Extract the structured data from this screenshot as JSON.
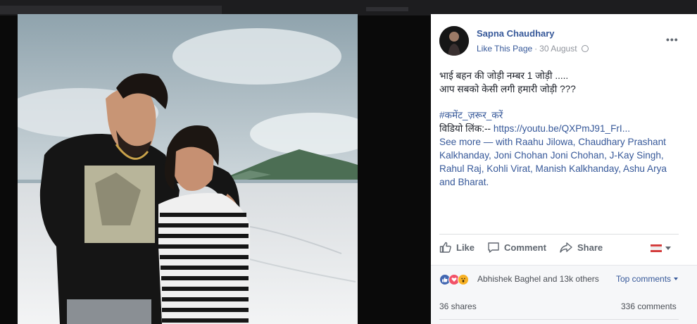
{
  "post": {
    "author": "Sapna Chaudhary",
    "like_page": "Like This Page",
    "separator": "·",
    "date": "30 August",
    "more_icon": "ellipsis-icon",
    "text_line1": "भाई बहन की जोड़ी नम्बर 1 जोड़ी .....",
    "text_line2": "आप सबको केसी लगी हमारी जोड़ी ???",
    "hashtag": "#कमेंट_ज़रूर_करें",
    "video_label": "विडियो लिंक:-- ",
    "video_link": "https://youtu.be/QXPmJ91_FrI...",
    "see_more": "See more",
    "with_prefix": " — with ",
    "tags": [
      "Raahu Jilowa",
      "Chaudhary Prashant Kalkhanday",
      "Joni Chohan Joni Chohan",
      "J-Kay Singh",
      "Rahul Raj",
      "Kohli Virat",
      "Manish Kalkhanday",
      "Ashu Arya"
    ],
    "tag_sep": ", ",
    "and_word": " and ",
    "last_tag": "Bharat",
    "end_dot": "."
  },
  "actions": {
    "like": "Like",
    "comment": "Comment",
    "share": "Share"
  },
  "feedback": {
    "reactions_text": "Abhishek Baghel and 13k others",
    "top_comments": "Top comments",
    "shares": "36 shares",
    "comments": "336 comments"
  },
  "colors": {
    "link": "#365899",
    "like_blue": "#4267b2",
    "love_red": "#f25268",
    "wow_yellow": "#f7b125"
  }
}
